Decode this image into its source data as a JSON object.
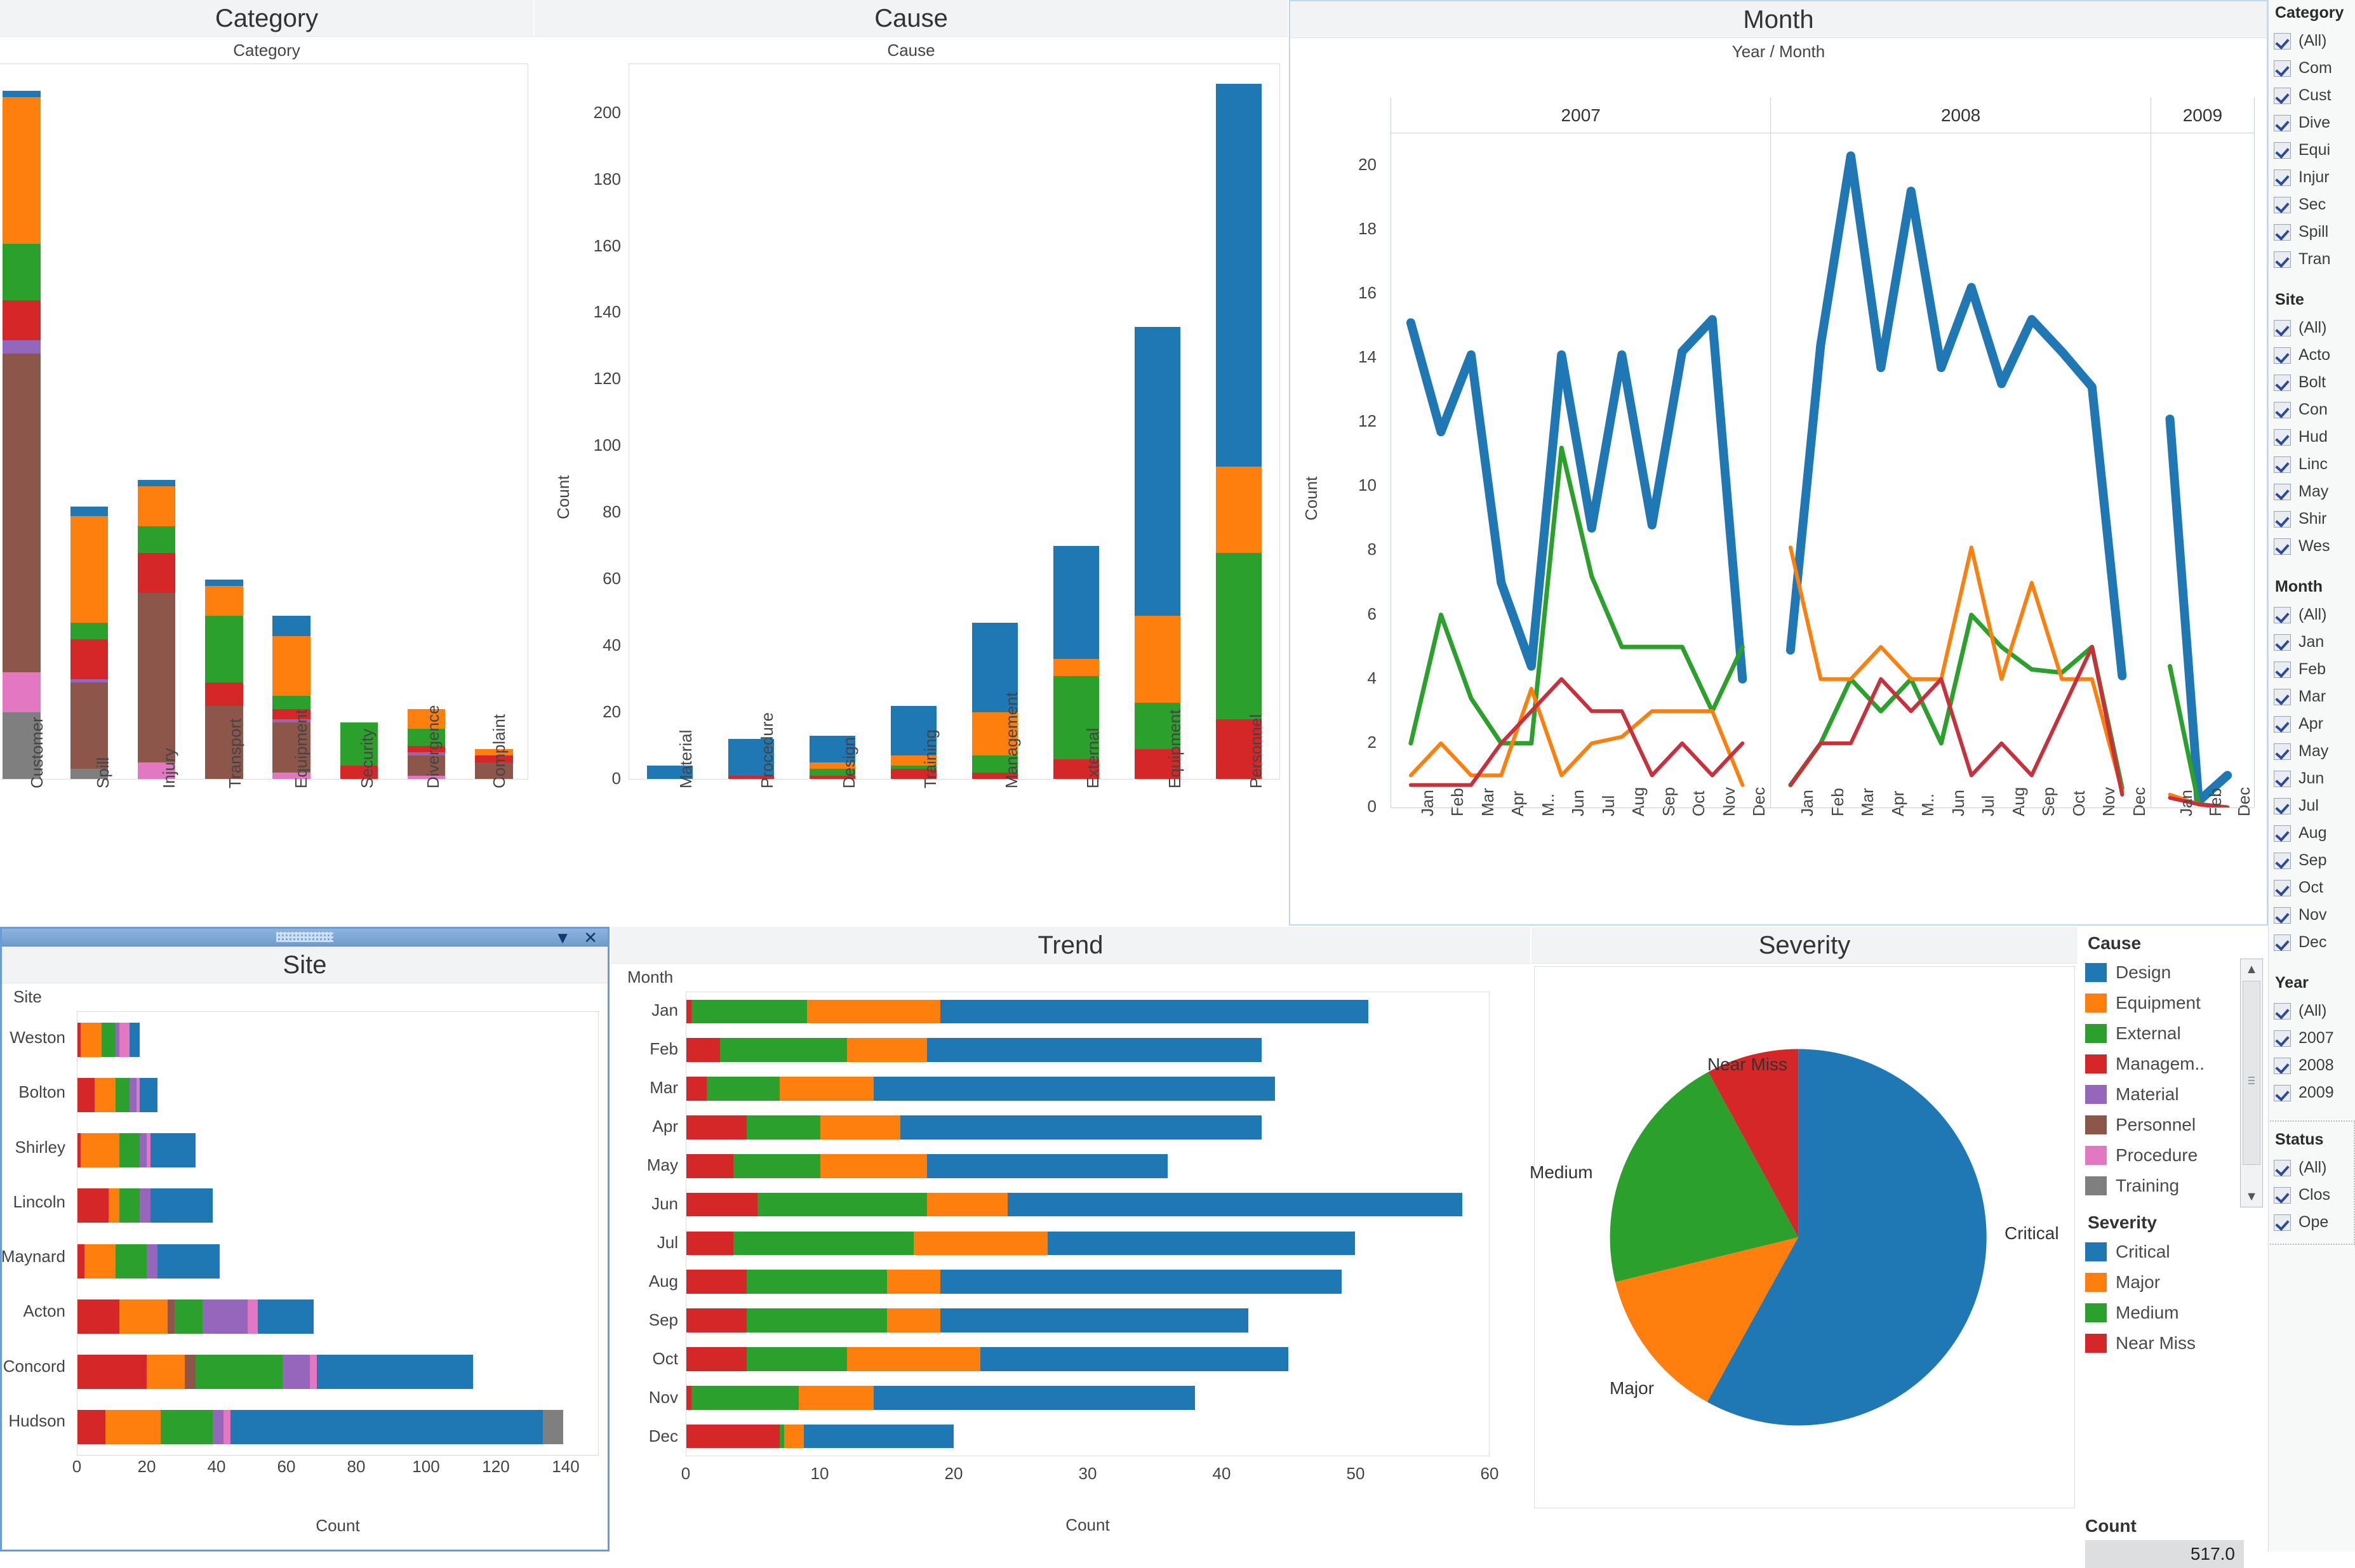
{
  "panels": {
    "category": {
      "title": "Category",
      "field_label": "Category"
    },
    "cause": {
      "title": "Cause",
      "field_label": "Cause",
      "y_axis_title": "Count"
    },
    "month": {
      "title": "Month",
      "field_label": "Year  /  Month",
      "y_axis_title": "Count",
      "popout_icon": "external-link-icon"
    },
    "site": {
      "title": "Site",
      "field_label": "Site",
      "x_axis_title": "Count",
      "minimize_icon": "chevron-down-icon",
      "close_icon": "close-icon"
    },
    "trend": {
      "title": "Trend",
      "field_label": "Month",
      "x_axis_title": "Count"
    },
    "severity": {
      "title": "Severity"
    }
  },
  "legend": {
    "cause_head": "Cause",
    "cause_items": [
      {
        "label": "Design",
        "color": "#1f77b4"
      },
      {
        "label": "Equipment",
        "color": "#ff7f0e"
      },
      {
        "label": "External",
        "color": "#2ca02c"
      },
      {
        "label": "Managem..",
        "color": "#d62728"
      },
      {
        "label": "Material",
        "color": "#9467bd"
      },
      {
        "label": "Personnel",
        "color": "#8c564b"
      },
      {
        "label": "Procedure",
        "color": "#e377c2"
      },
      {
        "label": "Training",
        "color": "#7f7f7f"
      }
    ],
    "severity_head": "Severity",
    "severity_items": [
      {
        "label": "Critical",
        "color": "#1f77b4"
      },
      {
        "label": "Major",
        "color": "#ff7f0e"
      },
      {
        "label": "Medium",
        "color": "#2ca02c"
      },
      {
        "label": "Near Miss",
        "color": "#d62728"
      }
    ],
    "count_head": "Count",
    "count_value": "517.0",
    "scroll_up_icon": "triangle-up-icon",
    "scroll_down_icon": "triangle-down-icon"
  },
  "filters": [
    {
      "head": "Category",
      "dashed": false,
      "items": [
        "(All)",
        "Com",
        "Cust",
        "Dive",
        "Equi",
        "Injur",
        "Sec",
        "Spill",
        "Tran"
      ]
    },
    {
      "head": "Site",
      "dashed": false,
      "items": [
        "(All)",
        "Acto",
        "Bolt",
        "Con",
        "Hud",
        "Linc",
        "May",
        "Shir",
        "Wes"
      ]
    },
    {
      "head": "Month",
      "dashed": false,
      "items": [
        "(All)",
        "Jan",
        "Feb",
        "Mar",
        "Apr",
        "May",
        "Jun",
        "Jul",
        "Aug",
        "Sep",
        "Oct",
        "Nov",
        "Dec"
      ]
    },
    {
      "head": "Year",
      "dashed": false,
      "items": [
        "(All)",
        "2007",
        "2008",
        "2009"
      ]
    },
    {
      "head": "Status",
      "dashed": true,
      "items": [
        "(All)",
        "Clos",
        "Ope"
      ]
    }
  ],
  "chart_data": [
    {
      "id": "category",
      "type": "bar",
      "title": "Category",
      "xlabel": "Category",
      "ylabel": "Count",
      "stacked": true,
      "ylim": [
        0,
        215
      ],
      "grid": false,
      "categories": [
        "Customer",
        "Spill",
        "Injury",
        "Transport",
        "Equipment",
        "Security",
        "Divergence",
        "Complaint"
      ],
      "legend_position": "right-external",
      "series": [
        {
          "name": "Training",
          "color": "#7f7f7f",
          "values": [
            20,
            3,
            0,
            0,
            0,
            0,
            0,
            0
          ]
        },
        {
          "name": "Procedure",
          "color": "#e377c2",
          "values": [
            12,
            0,
            5,
            0,
            2,
            0,
            1,
            0
          ]
        },
        {
          "name": "Personnel",
          "color": "#8c564b",
          "values": [
            96,
            26,
            51,
            22,
            15,
            0,
            6,
            5
          ]
        },
        {
          "name": "Material",
          "color": "#9467bd",
          "values": [
            4,
            1,
            0,
            0,
            1,
            0,
            1,
            0
          ]
        },
        {
          "name": "Managem..",
          "color": "#d62728",
          "values": [
            12,
            12,
            12,
            7,
            3,
            4,
            2,
            2
          ]
        },
        {
          "name": "External",
          "color": "#2ca02c",
          "values": [
            17,
            5,
            8,
            20,
            4,
            13,
            5,
            0
          ]
        },
        {
          "name": "Equipment",
          "color": "#ff7f0e",
          "values": [
            44,
            32,
            12,
            9,
            18,
            0,
            6,
            2
          ]
        },
        {
          "name": "Design",
          "color": "#1f77b4",
          "values": [
            2,
            3,
            2,
            2,
            6,
            0,
            0,
            0
          ]
        }
      ]
    },
    {
      "id": "cause",
      "type": "bar",
      "title": "Cause",
      "xlabel": "Cause",
      "ylabel": "Count",
      "stacked": true,
      "ylim": [
        0,
        215
      ],
      "yticks": [
        0,
        20,
        40,
        60,
        80,
        100,
        120,
        140,
        160,
        180,
        200
      ],
      "grid": false,
      "categories": [
        "Material",
        "Procedure",
        "Design",
        "Training",
        "Management",
        "External",
        "Equipment",
        "Personnel"
      ],
      "series": [
        {
          "name": "Near Miss",
          "color": "#d62728",
          "values": [
            0,
            1,
            1,
            3,
            2,
            6,
            9,
            18
          ]
        },
        {
          "name": "Medium",
          "color": "#2ca02c",
          "values": [
            0,
            0,
            2,
            1,
            5,
            25,
            14,
            50
          ]
        },
        {
          "name": "Major",
          "color": "#ff7f0e",
          "values": [
            0,
            0,
            2,
            3,
            13,
            5,
            26,
            26
          ]
        },
        {
          "name": "Critical",
          "color": "#1f77b4",
          "values": [
            4,
            11,
            8,
            15,
            27,
            34,
            87,
            115
          ]
        }
      ],
      "totals": [
        4,
        12,
        13,
        22,
        47,
        70,
        136,
        209
      ]
    },
    {
      "id": "month",
      "type": "line",
      "title": "Month",
      "xlabel": "Year  /  Month",
      "ylabel": "Count",
      "ylim": [
        0,
        21
      ],
      "yticks": [
        0,
        2,
        4,
        6,
        8,
        10,
        12,
        14,
        16,
        18,
        20
      ],
      "grid": false,
      "panes": [
        {
          "year": "2007",
          "months": [
            "Jan",
            "Feb",
            "Mar",
            "Apr",
            "M..",
            "Jun",
            "Jul",
            "Aug",
            "Sep",
            "Oct",
            "Nov",
            "Dec"
          ]
        },
        {
          "year": "2008",
          "months": [
            "Jan",
            "Feb",
            "Mar",
            "Apr",
            "M..",
            "Jun",
            "Jul",
            "Aug",
            "Sep",
            "Oct",
            "Nov",
            "Dec"
          ]
        },
        {
          "year": "2009",
          "months": [
            "Jan",
            "Feb",
            "Dec"
          ]
        }
      ],
      "series": [
        {
          "name": "Critical",
          "color": "#1f77b4",
          "width": 14,
          "values_2007": [
            15.1,
            11.7,
            14.1,
            7.0,
            4.4,
            14.1,
            8.7,
            14.1,
            8.8,
            14.2,
            15.2,
            4.0
          ],
          "values_2008": [
            4.9,
            14.4,
            20.3,
            13.7,
            19.2,
            13.7,
            16.2,
            13.2,
            15.2,
            14.2,
            13.1,
            4.1
          ],
          "values_2009": [
            12.1,
            0.2,
            1.0
          ]
        },
        {
          "name": "Medium",
          "color": "#2ca02c",
          "width": 7,
          "values_2007": [
            2.0,
            6.0,
            3.4,
            2.0,
            2.0,
            11.2,
            7.2,
            5.0,
            5.0,
            5.0,
            3.0,
            5.0
          ],
          "values_2008": [
            0.7,
            2.0,
            4.0,
            3.0,
            4.0,
            2.0,
            6.0,
            5.0,
            4.3,
            4.2,
            5.0,
            0.6
          ],
          "values_2009": [
            4.4,
            0.1,
            0.0
          ]
        },
        {
          "name": "Major",
          "color": "#ff7f0e",
          "width": 6,
          "values_2007": [
            1.0,
            2.0,
            1.0,
            1.0,
            3.7,
            1.0,
            2.0,
            2.2,
            3.0,
            3.0,
            3.0,
            0.7
          ],
          "values_2008": [
            8.1,
            4.0,
            4.0,
            5.0,
            4.0,
            4.0,
            8.1,
            4.0,
            7.0,
            4.0,
            4.0,
            0.5
          ],
          "values_2009": [
            0.4,
            0.1,
            0.0
          ]
        },
        {
          "name": "Near Miss",
          "color": "#c8313c",
          "width": 6,
          "values_2007": [
            0.7,
            0.7,
            0.7,
            2.0,
            3.0,
            4.0,
            3.0,
            3.0,
            1.0,
            2.0,
            1.0,
            2.0
          ],
          "values_2008": [
            0.7,
            2.0,
            2.0,
            4.0,
            3.0,
            4.0,
            1.0,
            2.0,
            1.0,
            3.0,
            5.0,
            0.4
          ],
          "values_2009": [
            0.3,
            0.1,
            0.0
          ]
        }
      ]
    },
    {
      "id": "site",
      "type": "bar",
      "orientation": "horizontal",
      "title": "Site",
      "ylabel": "Site",
      "xlabel": "Count",
      "stacked": true,
      "xlim": [
        0,
        150
      ],
      "xticks": [
        0,
        20,
        40,
        60,
        80,
        100,
        120,
        140
      ],
      "grid": false,
      "categories": [
        "Weston",
        "Bolton",
        "Shirley",
        "Lincoln",
        "Maynard",
        "Acton",
        "Concord",
        "Hudson"
      ],
      "series": [
        {
          "name": "Managem..",
          "color": "#d62728",
          "values": [
            1,
            5,
            1,
            9,
            2,
            12,
            20,
            8
          ]
        },
        {
          "name": "Equipment",
          "color": "#ff7f0e",
          "values": [
            6,
            6,
            11,
            3,
            9,
            14,
            11,
            16
          ]
        },
        {
          "name": "Personnel",
          "color": "#8c564b",
          "values": [
            0,
            0,
            0,
            0,
            0,
            2,
            3,
            0
          ]
        },
        {
          "name": "External",
          "color": "#2ca02c",
          "values": [
            4,
            4,
            6,
            6,
            9,
            8,
            25,
            15
          ]
        },
        {
          "name": "Material",
          "color": "#9467bd",
          "values": [
            1,
            2,
            2,
            3,
            3,
            13,
            8,
            3
          ]
        },
        {
          "name": "Procedure",
          "color": "#e377c2",
          "values": [
            3,
            1,
            1,
            0,
            0,
            3,
            2,
            2
          ]
        },
        {
          "name": "Design",
          "color": "#1f77b4",
          "values": [
            3,
            5,
            13,
            18,
            18,
            16,
            45,
            90
          ]
        },
        {
          "name": "Training",
          "color": "#7f7f7f",
          "values": [
            0,
            0,
            0,
            0,
            0,
            0,
            0,
            6
          ]
        }
      ],
      "totals": [
        21,
        23,
        34,
        40,
        45,
        78,
        120,
        149
      ]
    },
    {
      "id": "trend",
      "type": "bar",
      "orientation": "horizontal",
      "title": "Trend",
      "ylabel": "Month",
      "xlabel": "Count",
      "stacked": true,
      "xlim": [
        0,
        60
      ],
      "xticks": [
        0,
        10,
        20,
        30,
        40,
        50,
        60
      ],
      "grid": false,
      "categories": [
        "Jan",
        "Feb",
        "Mar",
        "Apr",
        "May",
        "Jun",
        "Jul",
        "Aug",
        "Sep",
        "Oct",
        "Nov",
        "Dec"
      ],
      "series": [
        {
          "name": "Near Miss",
          "color": "#d62728",
          "values": [
            0.4,
            2.5,
            1.5,
            4.5,
            3.5,
            5.3,
            3.5,
            4.5,
            4.5,
            4.5,
            0.4,
            7.0
          ]
        },
        {
          "name": "Medium",
          "color": "#2ca02c",
          "values": [
            8.6,
            9.5,
            5.5,
            5.5,
            6.5,
            12.7,
            13.5,
            10.5,
            10.5,
            7.5,
            8.0,
            0.3
          ]
        },
        {
          "name": "Major",
          "color": "#ff7f0e",
          "values": [
            10.0,
            6.0,
            7.0,
            6.0,
            8.0,
            6.0,
            10.0,
            4.0,
            4.0,
            10.0,
            5.6,
            1.5
          ]
        },
        {
          "name": "Critical",
          "color": "#1f77b4",
          "values": [
            32.0,
            25.0,
            30.0,
            27.0,
            18.0,
            34.0,
            23.0,
            30.0,
            23.0,
            23.0,
            24.0,
            11.2
          ]
        }
      ],
      "totals": [
        51,
        43,
        44,
        43,
        36,
        58,
        50,
        49,
        41,
        45,
        38,
        20
      ]
    },
    {
      "id": "severity",
      "type": "pie",
      "title": "Severity",
      "labels": [
        "Critical",
        "Major",
        "Medium",
        "Near Miss"
      ],
      "values": [
        300,
        68,
        108,
        41
      ],
      "colors": [
        "#1f77b4",
        "#ff7f0e",
        "#2ca02c",
        "#d62728"
      ],
      "total": 517,
      "label_positions": [
        "right",
        "bottom-left",
        "left",
        "top"
      ]
    }
  ]
}
